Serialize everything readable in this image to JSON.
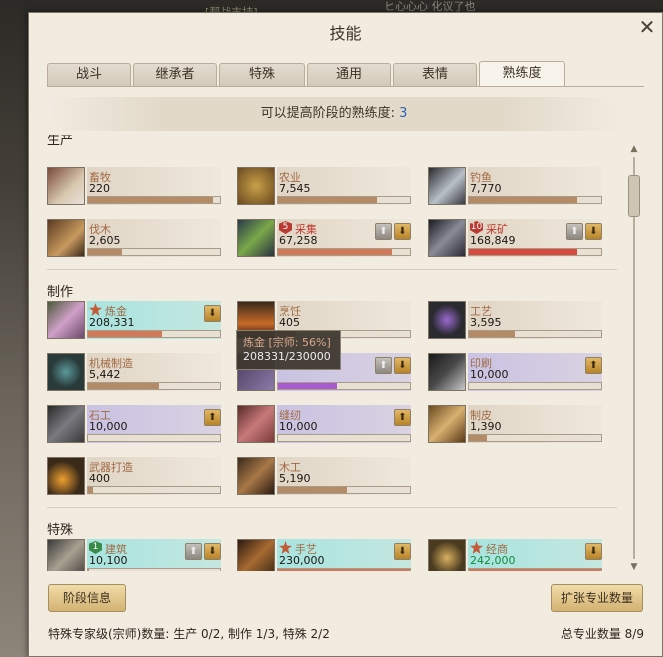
{
  "window": {
    "title": "技能"
  },
  "background": {
    "ghost_text_left": "[帮战支持]",
    "ghost_text_right": "ヒ心心心 化议了也"
  },
  "tabs": [
    {
      "label": "战斗",
      "active": false
    },
    {
      "label": "继承者",
      "active": false
    },
    {
      "label": "特殊",
      "active": false
    },
    {
      "label": "通用",
      "active": false
    },
    {
      "label": "表情",
      "active": false
    },
    {
      "label": "熟练度",
      "active": true
    }
  ],
  "banner": {
    "label": "可以提高阶段的熟练度:",
    "value": "3"
  },
  "sections": {
    "production": "生产",
    "crafting": "制作",
    "special": "特殊"
  },
  "skills": {
    "animal_husbandry": {
      "name": "畜牧",
      "value": "220",
      "progress": 0.95
    },
    "farming": {
      "name": "农业",
      "value": "7,545",
      "progress": 0.75
    },
    "fishing": {
      "name": "钓鱼",
      "value": "7,770",
      "progress": 0.82
    },
    "logging": {
      "name": "伐木",
      "value": "2,605",
      "progress": 0.26
    },
    "gathering": {
      "name": "采集",
      "value": "67,258",
      "progress": 0.86,
      "badge": "5"
    },
    "mining": {
      "name": "采矿",
      "value": "168,849",
      "progress": 0.82,
      "badge": "10"
    },
    "alchemy": {
      "name": "炼金",
      "value": "208,331",
      "progress": 0.56
    },
    "cooking": {
      "name": "烹饪",
      "value": "405",
      "progress": 0.14
    },
    "handicraft": {
      "name": "工艺",
      "value": "3,595",
      "progress": 0.35
    },
    "machining": {
      "name": "机械制造",
      "value": "5,442",
      "progress": 0.54
    },
    "unknown_purple": {
      "name": "",
      "value": "",
      "progress": 0.45
    },
    "printing": {
      "name": "印刷",
      "value": "10,000",
      "progress": 0.0
    },
    "masonry": {
      "name": "石工",
      "value": "10,000",
      "progress": 0.0
    },
    "tailoring": {
      "name": "缝纫",
      "value": "10,000",
      "progress": 0.0
    },
    "leatherwork": {
      "name": "制皮",
      "value": "1,390",
      "progress": 0.14
    },
    "weaponsmith": {
      "name": "武器打造",
      "value": "400",
      "progress": 0.04
    },
    "carpentry": {
      "name": "木工",
      "value": "5,190",
      "progress": 0.52
    },
    "construction": {
      "name": "建筑",
      "value": "10,100",
      "progress": 0.01,
      "badge": "1"
    },
    "artistry": {
      "name": "手艺",
      "value": "230,000",
      "progress": 1.0
    },
    "commerce": {
      "name": "经商",
      "value": "242,000",
      "progress": 1.0
    }
  },
  "tooltip": {
    "line1": "炼金 [宗师: 56%]",
    "line2": "208331/230000"
  },
  "buttons": {
    "stage_info": "阶段信息",
    "expand": "扩张专业数量"
  },
  "footer": {
    "left": "特殊专家级(宗师)数量: 生产 0/2, 制作 1/3, 特殊 2/2",
    "right": "总专业数量 8/9"
  },
  "colors": {
    "accent_blue": "#2a66b8",
    "value_green": "#138a3a",
    "badge_red": "#b83a30"
  }
}
